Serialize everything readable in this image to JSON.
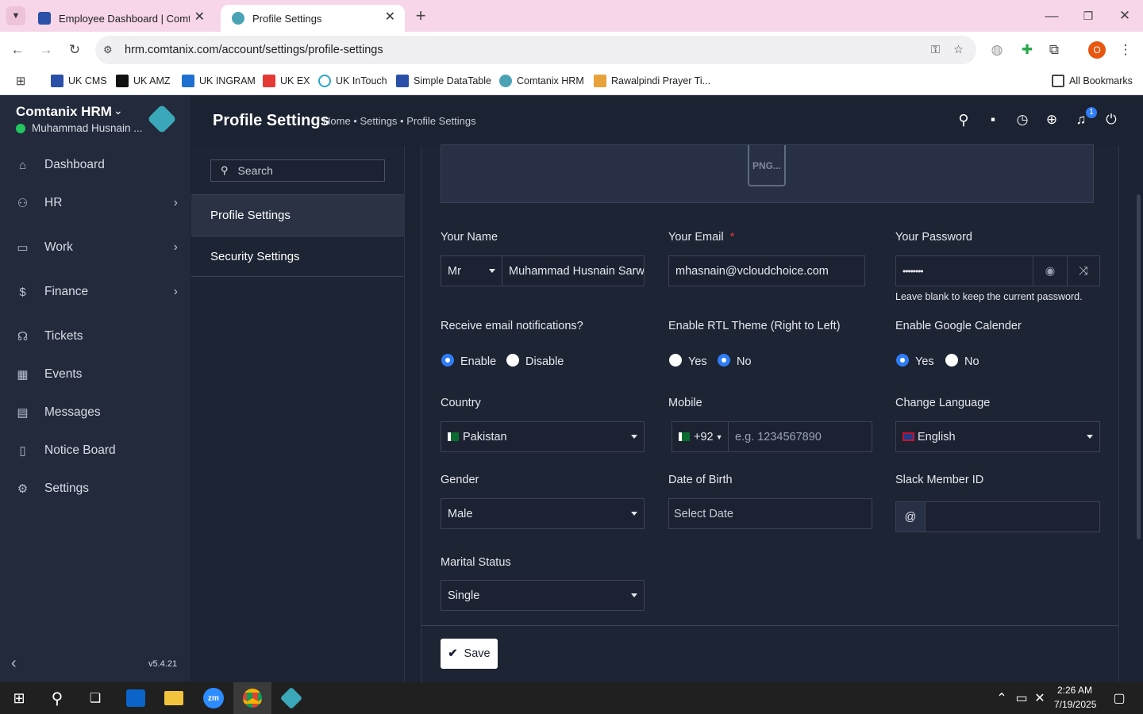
{
  "browser": {
    "tabs": [
      {
        "title": "Employee Dashboard | Comtan"
      },
      {
        "title": "Profile Settings"
      }
    ],
    "url": "hrm.comtanix.com/account/settings/profile-settings",
    "bookmarks": [
      "UK CMS",
      "UK AMZ",
      "UK INGRAM",
      "UK EX",
      "UK InTouch",
      "Simple DataTable",
      "Comtanix HRM",
      "Rawalpindi Prayer Ti..."
    ],
    "all_bookmarks": "All Bookmarks",
    "profile_initial": "O"
  },
  "sidebar": {
    "brand": "Comtanix HRM",
    "user": "Muhammad Husnain ...",
    "items": [
      {
        "label": "Dashboard",
        "icon": "home-icon"
      },
      {
        "label": "HR",
        "icon": "users-icon",
        "expand": true
      },
      {
        "label": "Work",
        "icon": "briefcase-icon",
        "expand": true
      },
      {
        "label": "Finance",
        "icon": "dollar-icon",
        "expand": true
      },
      {
        "label": "Tickets",
        "icon": "headset-icon"
      },
      {
        "label": "Events",
        "icon": "calendar-icon"
      },
      {
        "label": "Messages",
        "icon": "message-icon"
      },
      {
        "label": "Notice Board",
        "icon": "clipboard-icon"
      },
      {
        "label": "Settings",
        "icon": "gear-icon"
      }
    ],
    "version": "v5.4.21"
  },
  "header": {
    "title": "Profile Settings",
    "breadcrumb": "Home • Settings • Profile Settings",
    "notification_count": "1"
  },
  "settings_menu": {
    "search_placeholder": "Search",
    "items": [
      "Profile Settings",
      "Security Settings"
    ]
  },
  "form": {
    "upload_label": "PNG...",
    "name": {
      "label": "Your Name",
      "salutation": "Mr",
      "value": "Muhammad Husnain Sarw"
    },
    "email": {
      "label": "Your Email",
      "required": "*",
      "value": "mhasnain@vcloudchoice.com"
    },
    "password": {
      "label": "Your Password",
      "value": "••••••••",
      "hint": "Leave blank to keep the current password."
    },
    "email_notifications": {
      "label": "Receive email notifications?",
      "options": [
        "Enable",
        "Disable"
      ],
      "selected": "Enable"
    },
    "rtl": {
      "label": "Enable RTL Theme (Right to Left)",
      "options": [
        "Yes",
        "No"
      ],
      "selected": "No"
    },
    "google_calendar": {
      "label": "Enable Google Calender",
      "options": [
        "Yes",
        "No"
      ],
      "selected": "Yes"
    },
    "country": {
      "label": "Country",
      "value": "Pakistan"
    },
    "mobile": {
      "label": "Mobile",
      "code": "+92",
      "placeholder": "e.g. 1234567890"
    },
    "language": {
      "label": "Change Language",
      "value": "English"
    },
    "gender": {
      "label": "Gender",
      "value": "Male"
    },
    "dob": {
      "label": "Date of Birth",
      "placeholder": "Select Date"
    },
    "slack": {
      "label": "Slack Member ID",
      "prefix": "@"
    },
    "marital": {
      "label": "Marital Status",
      "value": "Single"
    },
    "save_label": "Save"
  },
  "taskbar": {
    "time": "2:26 AM",
    "date": "7/19/2025"
  },
  "colors": {
    "accent": "#2f7df6",
    "sidebar": "#222a3b",
    "content": "#1d2433",
    "required": "#e53935"
  }
}
